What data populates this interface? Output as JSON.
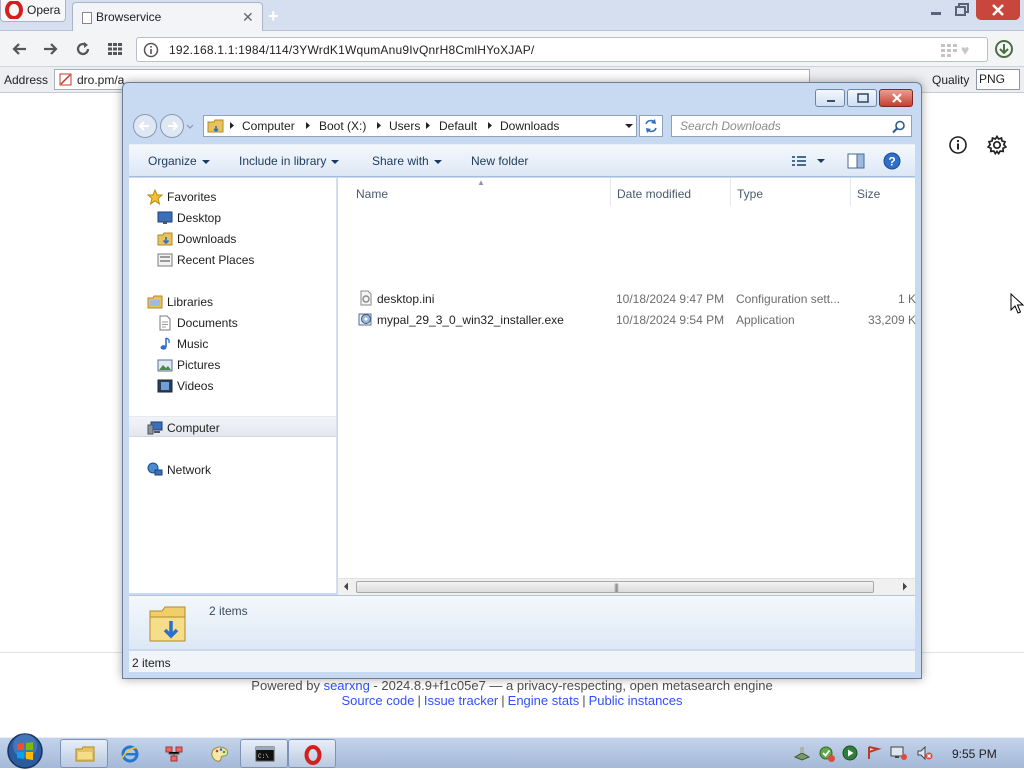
{
  "browser": {
    "menu_label": "Opera",
    "tab_title": "Browservice",
    "url": "192.168.1.1:1984/114/3YWrdK1WqumAnu9IvQnrH8CmlHYoXJAP/",
    "addon": {
      "address_label": "Address",
      "address_value": "dro.pm/a",
      "quality_label": "Quality",
      "quality_value": "PNG"
    }
  },
  "page": {
    "footer": {
      "powered_by_prefix": "Powered by ",
      "brand": "searxng",
      "powered_by_suffix": " - 2024.8.9+f1c05e7 — a privacy-respecting, open metasearch engine",
      "links": [
        {
          "label": "Source code"
        },
        {
          "label": "Issue tracker"
        },
        {
          "label": "Engine stats"
        },
        {
          "label": "Public instances"
        }
      ],
      "separator": "|"
    },
    "icons": [
      "info-icon",
      "gear-icon"
    ]
  },
  "explorer": {
    "breadcrumb": [
      "Computer",
      "Boot (X:)",
      "Users",
      "Default",
      "Downloads"
    ],
    "search_placeholder": "Search Downloads",
    "commands": {
      "organize": "Organize",
      "include_in_library": "Include in library",
      "share_with": "Share with",
      "new_folder": "New folder"
    },
    "nav": {
      "favorites": "Favorites",
      "desktop": "Desktop",
      "downloads": "Downloads",
      "recent_places": "Recent Places",
      "libraries": "Libraries",
      "documents": "Documents",
      "music": "Music",
      "pictures": "Pictures",
      "videos": "Videos",
      "computer": "Computer",
      "network": "Network"
    },
    "columns": {
      "name": "Name",
      "date_modified": "Date modified",
      "type": "Type",
      "size": "Size"
    },
    "files": [
      {
        "name": "desktop.ini",
        "date": "10/18/2024 9:47 PM",
        "type": "Configuration sett...",
        "size": "1 K",
        "icon": "ini-file-icon"
      },
      {
        "name": "mypal_29_3_0_win32_installer.exe",
        "date": "10/18/2024 9:54 PM",
        "type": "Application",
        "size": "33,209 K",
        "icon": "installer-exe-icon"
      }
    ],
    "details_count": "2 items",
    "status_count": "2 items"
  },
  "taskbar": {
    "clock": "9:55 PM",
    "pinned": [
      "explorer-icon",
      "ie-icon",
      "network-map-icon",
      "paint-icon",
      "cmd-icon",
      "opera-icon"
    ]
  }
}
